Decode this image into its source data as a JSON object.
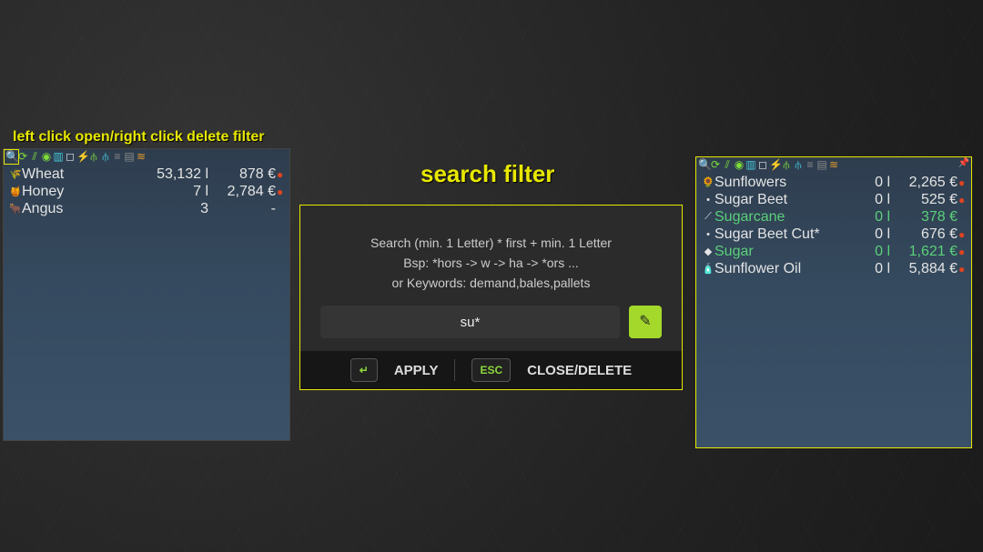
{
  "hint_text": "left click open/right click delete filter",
  "dialog_title": "search filter",
  "left_panel": {
    "rows": [
      {
        "icon": "🌾",
        "name": "Wheat",
        "qty": "53,132 l",
        "price": "878 €",
        "trend": "down"
      },
      {
        "icon": "🍯",
        "name": "Honey",
        "qty": "7 l",
        "price": "2,784 €",
        "trend": "down"
      },
      {
        "icon": "🐂",
        "name": "Angus",
        "qty": "3",
        "price": "-",
        "trend": ""
      }
    ]
  },
  "right_panel": {
    "rows": [
      {
        "icon": "🌻",
        "name": "Sunflowers",
        "qty": "0 l",
        "price": "2,265 €",
        "trend": "down",
        "highlight": false
      },
      {
        "icon": "•",
        "name": "Sugar Beet",
        "qty": "0 l",
        "price": "525 €",
        "trend": "down",
        "highlight": false
      },
      {
        "icon": "⟋",
        "name": "Sugarcane",
        "qty": "0 l",
        "price": "378 €",
        "trend": "",
        "highlight": true
      },
      {
        "icon": "•",
        "name": "Sugar Beet Cut*",
        "qty": "0 l",
        "price": "676 €",
        "trend": "down",
        "highlight": false
      },
      {
        "icon": "◆",
        "name": "Sugar",
        "qty": "0 l",
        "price": "1,621 €",
        "trend": "down",
        "highlight": true
      },
      {
        "icon": "🧴",
        "name": "Sunflower Oil",
        "qty": "0 l",
        "price": "5,884 €",
        "trend": "down",
        "highlight": false
      }
    ]
  },
  "dialog": {
    "line1": "Search (min. 1 Letter) * first + min. 1 Letter",
    "line2": "Bsp: *hors -> w -> ha -> *ors ...",
    "line3": "or Keywords: demand,bales,pallets",
    "input_value": "su*",
    "apply_label": "APPLY",
    "close_label": "CLOSE/DELETE",
    "enter_glyph": "↵",
    "esc_label": "ESC",
    "edit_glyph": "✎"
  },
  "toolbar_icons": [
    {
      "name": "search-icon",
      "glyph": "🔍",
      "cls": "c-white"
    },
    {
      "name": "refresh-icon",
      "glyph": "⟳",
      "cls": "c-green"
    },
    {
      "name": "chart-icon",
      "glyph": "⫽",
      "cls": "c-green"
    },
    {
      "name": "globe-icon",
      "glyph": "◉",
      "cls": "c-green"
    },
    {
      "name": "stack-icon",
      "glyph": "▥",
      "cls": "c-cyan"
    },
    {
      "name": "box-icon",
      "glyph": "◻",
      "cls": "c-white"
    },
    {
      "name": "flash-icon",
      "glyph": "⚡",
      "cls": "c-yellow"
    },
    {
      "name": "sliders-a-icon",
      "glyph": "⫛",
      "cls": "c-green"
    },
    {
      "name": "sliders-b-icon",
      "glyph": "⫛",
      "cls": "c-cyan"
    },
    {
      "name": "storage-icon",
      "glyph": "≡",
      "cls": "c-grey"
    },
    {
      "name": "print-icon",
      "glyph": "▤",
      "cls": "c-grey"
    },
    {
      "name": "filter-icon",
      "glyph": "≋",
      "cls": "c-orange"
    }
  ]
}
